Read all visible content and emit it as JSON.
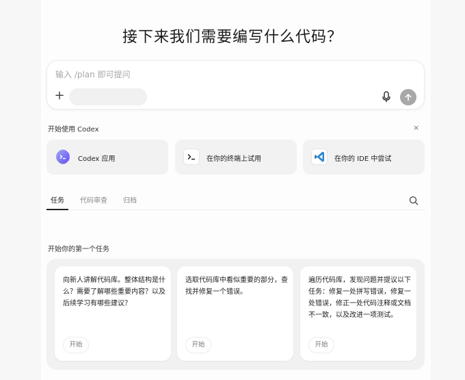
{
  "headline": "接下来我们需要编写什么代码？",
  "composer": {
    "placeholder": "输入 /plan 即可提问",
    "plus_icon": "plus-icon",
    "mic_icon": "microphone-icon",
    "send_icon": "arrow-up-icon"
  },
  "getting_started": {
    "title": "开始使用 Codex",
    "close_label": "×",
    "cards": [
      {
        "label": "Codex 应用",
        "icon": "codex-app-icon"
      },
      {
        "label": "在你的终端上试用",
        "icon": "terminal-icon"
      },
      {
        "label": "在你的 IDE 中尝试",
        "icon": "vscode-icon"
      }
    ]
  },
  "tabs": [
    {
      "label": "任务",
      "active": true
    },
    {
      "label": "代码审查",
      "active": false
    },
    {
      "label": "归档",
      "active": false
    }
  ],
  "first_task": {
    "title": "开始你的第一个任务",
    "cards": [
      {
        "text": "向新人讲解代码库。整体结构是什么？需要了解哪些重要内容？以及后续学习有哪些建议？",
        "button": "开始"
      },
      {
        "text": "选取代码库中看似重要的部分，查找并修复一个错误。",
        "button": "开始"
      },
      {
        "text": "遍历代码库，发现问题并提议以下任务：修复一处拼写错误，修复一处错误，修正一处代码注释或文档不一致，以及改进一项测试。",
        "button": "开始"
      }
    ]
  },
  "colors": {
    "background": "#f7f7f8",
    "send_button": "#a8a8a8",
    "codex_icon": "#7b6ff0",
    "vscode_icon": "#2a8ad4"
  }
}
